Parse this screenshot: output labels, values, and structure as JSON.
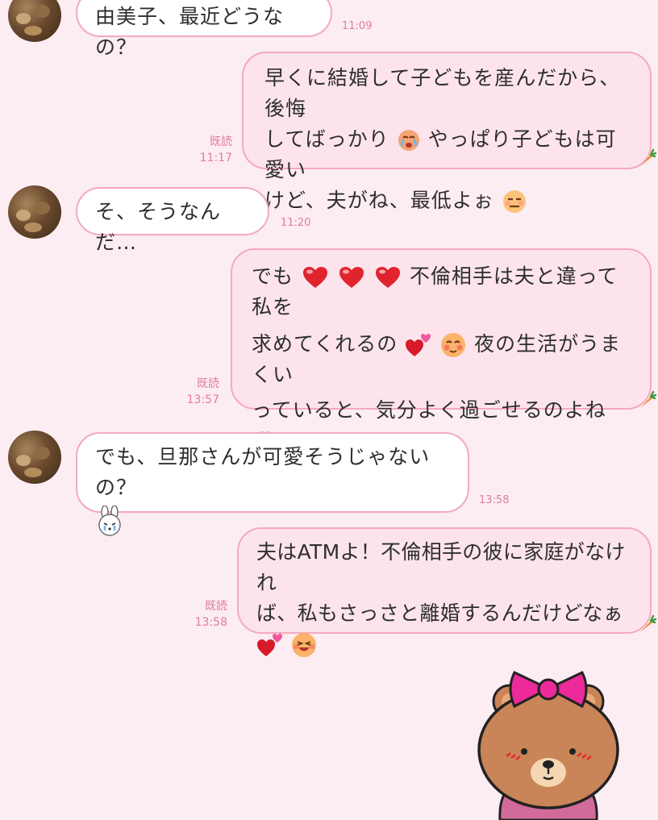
{
  "messages": [
    {
      "id": "m1",
      "side": "in",
      "text": "由美子、最近どうなの？",
      "time": "11:09"
    },
    {
      "id": "m2",
      "side": "out",
      "lines": [
        "早くに結婚して子どもを産んだから、後悔",
        "してばっかり",
        "やっぱり子どもは可愛い",
        "けど、夫がね、最低よぉ"
      ],
      "read": "既読",
      "time": "11:17"
    },
    {
      "id": "m3",
      "side": "in",
      "text": "そ、そうなんだ…",
      "time": "11:20"
    },
    {
      "id": "m4",
      "side": "out",
      "lines": [
        "でも",
        "不倫相手は夫と違って私を",
        "求めてくれるの",
        "夜の生活がうまくい",
        "っていると、気分よく過ごせるのよね"
      ],
      "read": "既読",
      "time": "13:57"
    },
    {
      "id": "m5",
      "side": "in",
      "text": "でも、旦那さんが可愛そうじゃないの？",
      "time": "13:58"
    },
    {
      "id": "m6",
      "side": "out",
      "lines": [
        "夫はATMよ！不倫相手の彼に家庭がなけれ",
        "ば、私もさっさと離婚するんだけどなぁ"
      ],
      "read": "既読",
      "time": "13:58"
    }
  ],
  "icons": {
    "avatar": "avatar-food-photo",
    "carrot": "carrot-icon",
    "sticker": "brown-bear-bow-sticker"
  },
  "colors": {
    "background": "#fcedf2",
    "bubble_border": "#f3a9c1",
    "bubble_out": "#fde4ec",
    "bubble_in": "#ffffff",
    "meta_text": "#e07ca0"
  }
}
